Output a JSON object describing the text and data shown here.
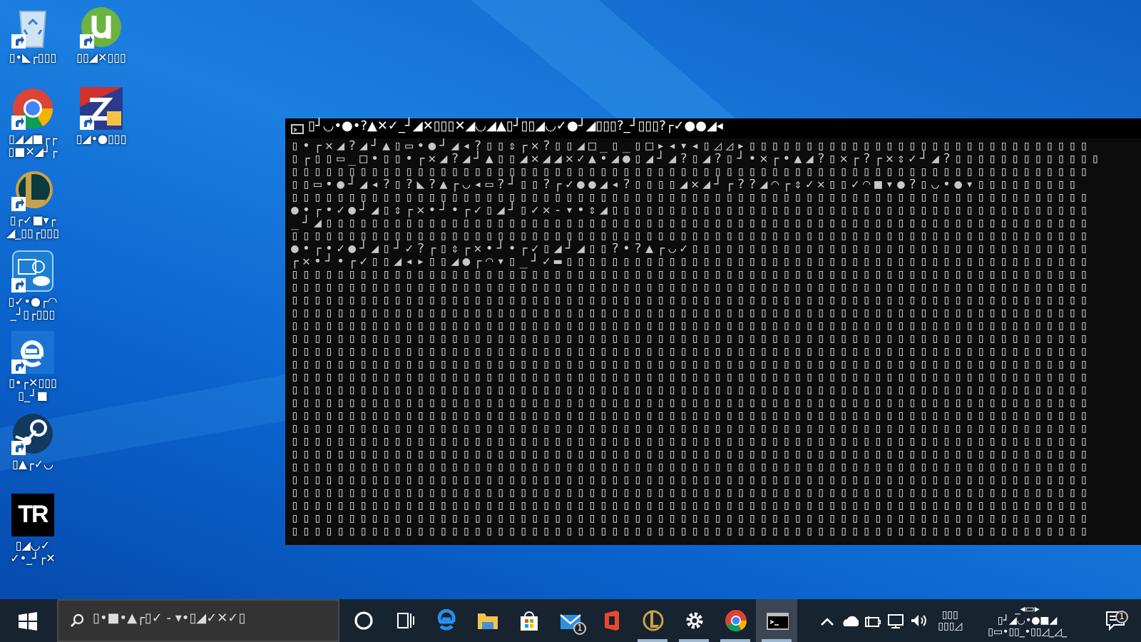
{
  "desktop_icons": [
    {
      "kind": "bin",
      "label": [
        "▯•◣┌▯▯▯"
      ]
    },
    {
      "kind": "chrome",
      "label": [
        "▯◢◢■┌┌",
        "▯■✕◢┘┌"
      ]
    },
    {
      "kind": "league",
      "label": [
        "▯┌✓■▾┌",
        "◢_▯▯┌▯▯▯"
      ]
    },
    {
      "kind": "intel",
      "label": [
        "▯✓•●┌◠",
        "_┘▯┌▯▯▯"
      ]
    },
    {
      "kind": "edge",
      "label": [
        "▯•┌✕▯▯▯",
        "▯_┘■"
      ]
    },
    {
      "kind": "steam",
      "label": [
        "▯▲┌✓◡"
      ]
    },
    {
      "kind": "tr",
      "logo_text": "TR",
      "label": [
        "▯◢◡✓",
        "✓•_┘┌✕"
      ]
    },
    {
      "kind": "torrent",
      "label": [
        "▯▯◢✕▯▯▯"
      ]
    },
    {
      "kind": "zz",
      "label": [
        "▯◢•●▯▯▯"
      ]
    }
  ],
  "console": {
    "title": "▯┘◡•●•?▲✕✓_┘◢✕▯▯▯✕◢◡◢▲▯┘▯▯◢◡✓●┘◢▯▯▯?_┘▯▯▯?┌✓●●◢◂",
    "lines": [
      "▯•┌✕◢?◢┘▲▯▭•●┘◢◂?▯▯⇕┌✕?▯▯◢□_▯_▯□▸◂▾◂▯◿◿▸▯▯▯▯▯▯▯▯▯▯▯▯▯▯▯▯▯▯▯▯▯▯▯▯▯▯▯▯▯▯",
      "▯┌▯▯▭_□•▯▯•┌✕◢?◢┘▲▯▯◢✕◢◢✕✓▲•◢●▯◢┘◢?▯◢?▯┘•✕┌•▲◢?▯✕┌?┌✕⇕✓┘◢?▯▯▯▯▯▯▯▯▯▯▯▯▯",
      "▯▯▯▯▯▯▯▯▯▯▯▯▯▯▯▯▯▯▯▯▯▯▯▯▯▯▯▯▯▯▯▯▯▯▯▯▯▯▯▯▯▯▯▯▯▯▯▯▯▯▯▯▯▯▯▯▯▯▯▯▯▯▯▯▯▯▯▯▯▯",
      "▯▯▭•●┘◢◂?▯?◣?▲┌◡◂▭?┘▯▯?┌✓●●◢◂?▯▯▯▯◢✕◢┘┌??◢◠┌⇕✓✕▯▯✓◠■▾●?▯◡•●▾▯▯▯▯▯▯▯▯▯",
      "▯▯▯▯▯▯▯▯▯▯▯▯▯▯▯▯▯▯▯▯▯▯▯▯▯▯▯▯▯▯▯▯▯▯▯▯▯▯▯▯▯▯▯▯▯▯▯▯▯▯▯▯▯▯▯▯▯▯▯▯▯▯▯▯▯▯▯▯▯▯",
      "●•┌•✓●┘◢▯⇕┌✕•┘•┌✓▯◢┘▯✓✕-▾•⇕◢▯▯▯▯▯▯▯▯▯▯▯▯▯▯▯▯▯▯▯▯▯▯▯▯▯▯▯▯▯▯▯▯▯▯▯▯▯▯▯▯▯▯",
      "_┘◢▯▯▯▯▯▯▯▯▯▯▯▯▯▯▯▯▯▯▯▯▯▯▯▯▯▯▯▯▯▯▯▯▯▯▯▯▯▯▯▯▯▯▯▯▯▯▯▯▯▯▯▯▯▯▯▯▯▯▯▯▯▯▯▯▯▯▯",
      "▯▯▯▯▯▯▯▯▯▯▯▯▯▯▯▯▯▯▯▯▯▯▯▯▯▯▯▯▯▯▯▯▯▯▯▯▯▯▯▯▯▯▯▯▯▯▯▯▯▯▯▯▯▯▯▯▯▯▯▯▯▯▯▯▯▯▯▯▯▯",
      "●•┌•✓●┘◢▯┘✓?┌▯⇕┌✕•┘•┌✓▯◢┘◢▯▯?•?▲┌◡✓▯▯▯▯▯▯▯▯▯▯▯▯▯▯▯▯▯▯▯▯▯▯▯▯▯▯▯▯▯▯▯▯▯▯▯",
      "┌✕•┘•┌✓▯▯◢◂▸▯▯◢●┌◠▾▯_┘✓▬▯▯▯▯▯▯▯▯▯▯▯▯▯▯▯▯▯▯▯▯▯▯▯▯▯▯▯▯▯▯▯▯▯▯▯▯▯▯▯▯▯▯▯▯▯▯",
      "▯▯▯▯▯▯▯▯▯▯▯▯▯▯▯▯▯▯▯▯▯▯▯▯▯▯▯▯▯▯▯▯▯▯▯▯▯▯▯▯▯▯▯▯▯▯▯▯▯▯▯▯▯▯▯▯▯▯▯▯▯▯▯▯▯▯▯▯▯▯",
      "▯▯▯▯▯▯▯▯▯▯▯▯▯▯▯▯▯▯▯▯▯▯▯▯▯▯▯▯▯▯▯▯▯▯▯▯▯▯▯▯▯▯▯▯▯▯▯▯▯▯▯▯▯▯▯▯▯▯▯▯▯▯▯▯▯▯▯▯▯▯",
      "▯▯▯▯▯▯▯▯▯▯▯▯▯▯▯▯▯▯▯▯▯▯▯▯▯▯▯▯▯▯▯▯▯▯▯▯▯▯▯▯▯▯▯▯▯▯▯▯▯▯▯▯▯▯▯▯▯▯▯▯▯▯▯▯▯▯▯▯▯▯",
      "▯▯▯▯▯▯▯▯▯▯▯▯▯▯▯▯▯▯▯▯▯▯▯▯▯▯▯▯▯▯▯▯▯▯▯▯▯▯▯▯▯▯▯▯▯▯▯▯▯▯▯▯▯▯▯▯▯▯▯▯▯▯▯▯▯▯▯▯▯▯",
      "▯▯▯▯▯▯▯▯▯▯▯▯▯▯▯▯▯▯▯▯▯▯▯▯▯▯▯▯▯▯▯▯▯▯▯▯▯▯▯▯▯▯▯▯▯▯▯▯▯▯▯▯▯▯▯▯▯▯▯▯▯▯▯▯▯▯▯▯▯▯",
      "▯▯▯▯▯▯▯▯▯▯▯▯▯▯▯▯▯▯▯▯▯▯▯▯▯▯▯▯▯▯▯▯▯▯▯▯▯▯▯▯▯▯▯▯▯▯▯▯▯▯▯▯▯▯▯▯▯▯▯▯▯▯▯▯▯▯▯▯▯▯",
      "▯▯▯▯▯▯▯▯▯▯▯▯▯▯▯▯▯▯▯▯▯▯▯▯▯▯▯▯▯▯▯▯▯▯▯▯▯▯▯▯▯▯▯▯▯▯▯▯▯▯▯▯▯▯▯▯▯▯▯▯▯▯▯▯▯▯▯▯▯▯",
      "▯▯▯▯▯▯▯▯▯▯▯▯▯▯▯▯▯▯▯▯▯▯▯▯▯▯▯▯▯▯▯▯▯▯▯▯▯▯▯▯▯▯▯▯▯▯▯▯▯▯▯▯▯▯▯▯▯▯▯▯▯▯▯▯▯▯▯▯▯▯",
      "▯▯▯▯▯▯▯▯▯▯▯▯▯▯▯▯▯▯▯▯▯▯▯▯▯▯▯▯▯▯▯▯▯▯▯▯▯▯▯▯▯▯▯▯▯▯▯▯▯▯▯▯▯▯▯▯▯▯▯▯▯▯▯▯▯▯▯▯▯▯",
      "▯▯▯▯▯▯▯▯▯▯▯▯▯▯▯▯▯▯▯▯▯▯▯▯▯▯▯▯▯▯▯▯▯▯▯▯▯▯▯▯▯▯▯▯▯▯▯▯▯▯▯▯▯▯▯▯▯▯▯▯▯▯▯▯▯▯▯▯▯▯",
      "▯▯▯▯▯▯▯▯▯▯▯▯▯▯▯▯▯▯▯▯▯▯▯▯▯▯▯▯▯▯▯▯▯▯▯▯▯▯▯▯▯▯▯▯▯▯▯▯▯▯▯▯▯▯▯▯▯▯▯▯▯▯▯▯▯▯▯▯▯▯",
      "▯▯▯▯▯▯▯▯▯▯▯▯▯▯▯▯▯▯▯▯▯▯▯▯▯▯▯▯▯▯▯▯▯▯▯▯▯▯▯▯▯▯▯▯▯▯▯▯▯▯▯▯▯▯▯▯▯▯▯▯▯▯▯▯▯▯▯▯▯▯",
      "▯▯▯▯▯▯▯▯▯▯▯▯▯▯▯▯▯▯▯▯▯▯▯▯▯▯▯▯▯▯▯▯▯▯▯▯▯▯▯▯▯▯▯▯▯▯▯▯▯▯▯▯▯▯▯▯▯▯▯▯▯▯▯▯▯▯▯▯▯▯",
      "▯▯▯▯▯▯▯▯▯▯▯▯▯▯▯▯▯▯▯▯▯▯▯▯▯▯▯▯▯▯▯▯▯▯▯▯▯▯▯▯▯▯▯▯▯▯▯▯▯▯▯▯▯▯▯▯▯▯▯▯▯▯▯▯▯▯▯▯▯▯",
      "▯▯▯▯▯▯▯▯▯▯▯▯▯▯▯▯▯▯▯▯▯▯▯▯▯▯▯▯▯▯▯▯▯▯▯▯▯▯▯▯▯▯▯▯▯▯▯▯▯▯▯▯▯▯▯▯▯▯▯▯▯▯▯▯▯▯▯▯▯▯",
      "▯▯▯▯▯▯▯▯▯▯▯▯▯▯▯▯▯▯▯▯▯▯▯▯▯▯▯▯▯▯▯▯▯▯▯▯▯▯▯▯▯▯▯▯▯▯▯▯▯▯▯▯▯▯▯▯▯▯▯▯▯▯▯▯▯▯▯▯▯▯",
      "▯▯▯▯▯▯▯▯▯▯▯▯▯▯▯▯▯▯▯▯▯▯▯▯▯▯▯▯▯▯▯▯▯▯▯▯▯▯▯▯▯▯▯▯▯▯▯▯▯▯▯▯▯▯▯▯▯▯▯▯▯▯▯▯▯▯▯▯▯▯",
      "▯▯▯▯▯▯▯▯▯▯▯▯▯▯▯▯▯▯▯▯▯▯▯▯▯▯▯▯▯▯▯▯▯▯▯▯▯▯▯▯▯▯▯▯▯▯▯▯▯▯▯▯▯▯▯▯▯▯▯▯▯▯▯▯▯▯▯▯▯▯",
      "▯▯▯▯▯▯▯▯▯▯▯▯▯▯▯▯▯▯▯▯▯▯▯▯▯▯▯▯▯▯▯▯▯▯▯▯▯▯▯▯▯▯▯▯▯▯▯▯▯▯▯▯▯▯▯▯▯▯▯▯▯▯▯▯▯▯▯▯▯▯",
      "▯▯▯▯▯▯▯▯▯▯▯▯▯▯▯▯▯▯▯▯▯▯▯▯▯▯▯▯▯▯▯▯▯▯▯▯▯▯▯▯▯▯▯▯▯▯▯▯▯▯▯▯▯▯▯▯▯▯▯▯▯▯▯▯▯▯▯▯▯▯",
      "▯▯▯▯▯▯▯▯▯▯▯▯▯▯▯▯▯▯▯▯▯▯▯▯▯▯▯▯▯▯▯▯▯▯▯▯▯▯▯▯▯▯▯▯▯▯▯▯▯▯▯▯▯▯▯▯▯▯▯▯▯▯▯▯▯▯▯▯▯▯"
    ]
  },
  "taskbar": {
    "search": {
      "placeholder": "▯•■•▲┌▯✓ - ▾•▯◢✓✕✓▯"
    },
    "apps": [
      {
        "kind": "cortana",
        "active": false,
        "running": false
      },
      {
        "kind": "taskview",
        "active": false,
        "running": false
      },
      {
        "kind": "edge",
        "active": false,
        "running": false
      },
      {
        "kind": "folder",
        "active": false,
        "running": false
      },
      {
        "kind": "store",
        "active": false,
        "running": false
      },
      {
        "kind": "mail",
        "active": false,
        "running": false,
        "badge": "1"
      },
      {
        "kind": "office",
        "active": false,
        "running": false
      },
      {
        "kind": "league",
        "active": false,
        "running": true
      },
      {
        "kind": "gear",
        "active": false,
        "running": true
      },
      {
        "kind": "chrome",
        "active": false,
        "running": true
      },
      {
        "kind": "console",
        "active": true,
        "running": true
      }
    ],
    "tray": [
      {
        "kind": "chevron"
      },
      {
        "kind": "cloud"
      },
      {
        "kind": "battery"
      },
      {
        "kind": "monitor"
      },
      {
        "kind": "volume"
      }
    ],
    "language": [
      "▯▯▯",
      "▯▯▯◿"
    ],
    "clock": [
      "_◂▭▸",
      "▯┘◢◡•●■◢",
      "▯▭•▯▯_•▯▯◿_◿_"
    ],
    "notification_badge": "1"
  }
}
